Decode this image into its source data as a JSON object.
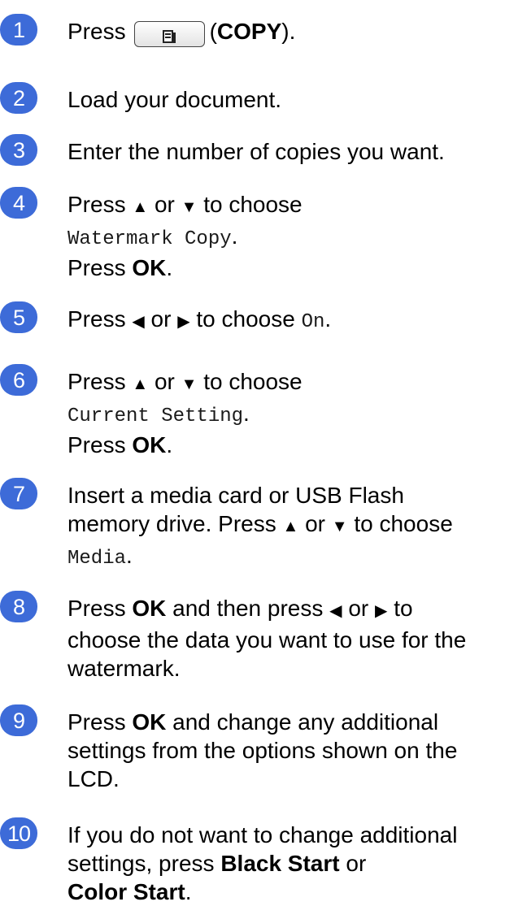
{
  "accent_color": "#3d6bd8",
  "steps": [
    {
      "num": "1",
      "p1": "Press",
      "p2": "(",
      "bold": "COPY",
      "p3": ")."
    },
    {
      "num": "2",
      "text": "Load your document."
    },
    {
      "num": "3",
      "text": "Enter the number of copies you want."
    },
    {
      "num": "4",
      "p1": "Press",
      "p2": "or",
      "p3": "to choose",
      "mono": "Watermark Copy",
      "p4": ".",
      "p5": "Press",
      "bold": "OK",
      "p6": "."
    },
    {
      "num": "5",
      "p1": "Press",
      "p2": "or",
      "p3": "to choose",
      "mono": "On",
      "p4": "."
    },
    {
      "num": "6",
      "p1": "Press",
      "p2": "or",
      "p3": "to choose",
      "mono": "Current Setting",
      "p4": ".",
      "p5": "Press",
      "bold": "OK",
      "p6": "."
    },
    {
      "num": "7",
      "p1": "Insert a media card or USB Flash",
      "p2": "memory drive. Press",
      "p3": "or",
      "p4": "to choose",
      "mono": "Media",
      "p5": "."
    },
    {
      "num": "8",
      "p1": "Press",
      "bold": "OK",
      "p2": "and then press",
      "p3": "or",
      "p4": "to",
      "p5": "choose the data you want to use for the",
      "p6": "watermark."
    },
    {
      "num": "9",
      "p1": "Press",
      "bold": "OK",
      "p2": "and change any additional",
      "p3": "settings from the options shown on the",
      "p4": "LCD."
    },
    {
      "num": "10",
      "p1": "If you do not want to change additional",
      "p2": "settings, press",
      "bold1": "Black Start",
      "p3": "or",
      "bold2": "Color Start",
      "p4": "."
    }
  ]
}
